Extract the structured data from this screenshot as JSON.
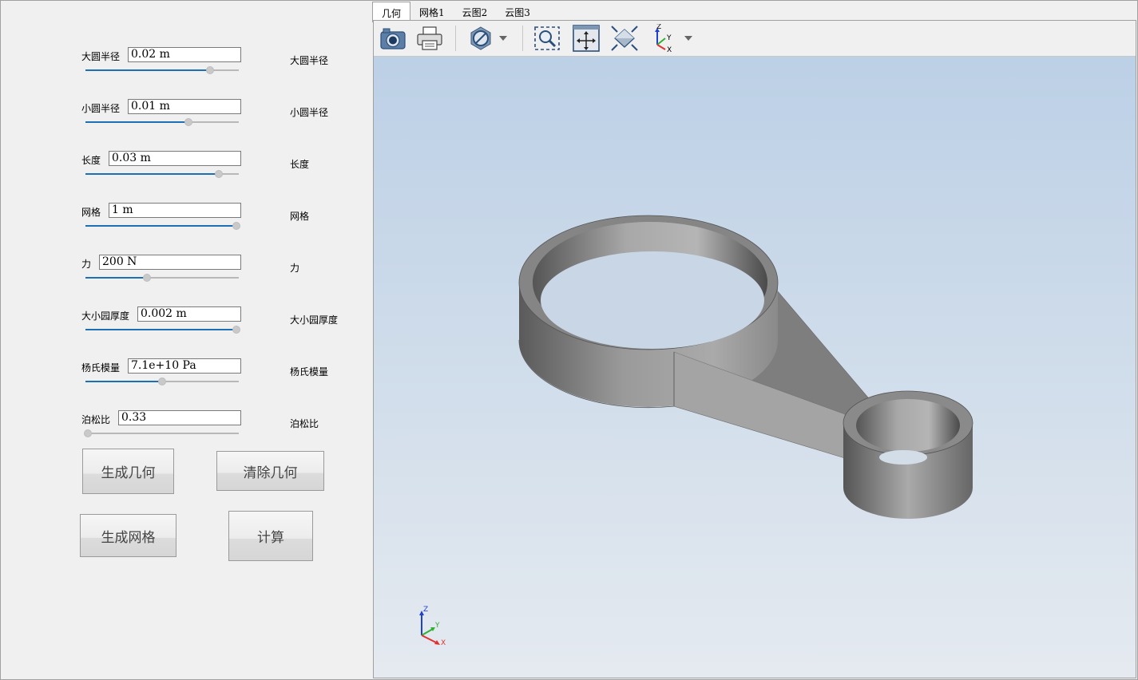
{
  "params": [
    {
      "label": "大圆半径",
      "value": "0.02 m",
      "right_label": "大圆半径",
      "level": 0.82
    },
    {
      "label": "小圆半径",
      "value": "0.01 m",
      "right_label": "小圆半径",
      "level": 0.68
    },
    {
      "label": "长度",
      "value": "0.03 m",
      "right_label": "长度",
      "level": 0.88
    },
    {
      "label": "网格",
      "value": "1 m",
      "right_label": "网格",
      "level": 1.0
    },
    {
      "label": "力",
      "value": "200 N",
      "right_label": "力",
      "level": 0.4
    },
    {
      "label": "大小园厚度",
      "value": "0.002 m",
      "right_label": "大小园厚度",
      "level": 1.0
    },
    {
      "label": "杨氏模量",
      "value": "7.1e+10 Pa",
      "right_label": "杨氏模量",
      "level": 0.5
    },
    {
      "label": "泊松比",
      "value": "0.33",
      "right_label": "泊松比",
      "level": 0.0
    }
  ],
  "buttons": {
    "generate_geometry": "生成几何",
    "clear_geometry": "清除几何",
    "generate_mesh": "生成网格",
    "compute": "计算"
  },
  "tabs": [
    "几何",
    "网格1",
    "云图2",
    "云图3"
  ],
  "active_tab": 0,
  "toolbar_icons": [
    "camera-icon",
    "print-icon",
    "hide-icon",
    "dropdown-arrow-icon",
    "zoom-box-icon",
    "fit-view-icon",
    "view-iso-icon",
    "axes-orientation-icon",
    "dropdown-arrow-icon"
  ],
  "axes": {
    "x": "X",
    "y": "Y",
    "z": "Z"
  },
  "colors": {
    "slider_fill": "#1f6fb5",
    "viewport_top": "#bcd0e6",
    "viewport_bottom": "#e5eaf0",
    "axis_x": "#e03030",
    "axis_y": "#30b030",
    "axis_z": "#2040d0"
  }
}
